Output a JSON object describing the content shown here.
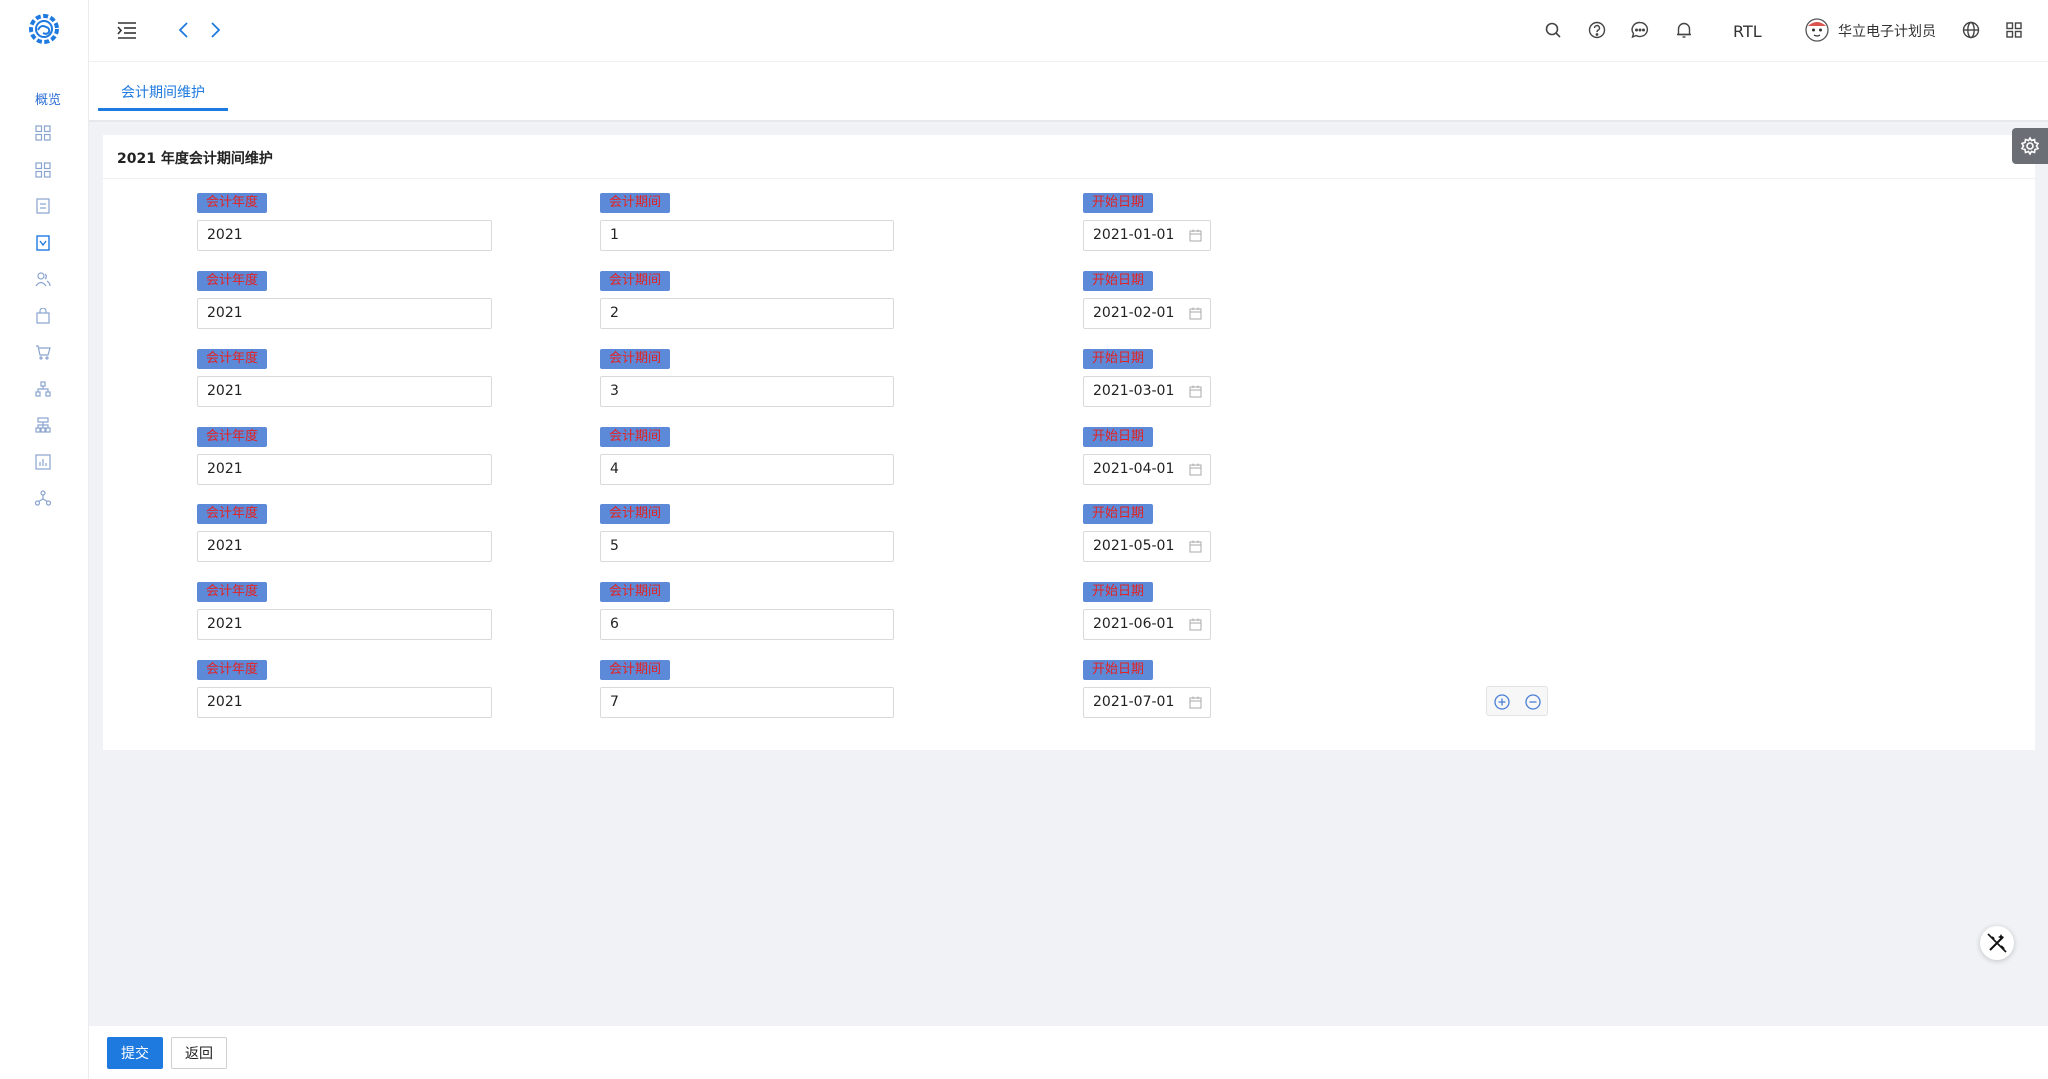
{
  "sidebar": {
    "overview_label": "概览",
    "icons": [
      "grid-icon",
      "grid-icon",
      "document-icon",
      "download-box-icon",
      "users-icon",
      "bag-icon",
      "cart-icon",
      "org-chart-icon",
      "hierarchy-icon",
      "report-icon",
      "network-icon"
    ]
  },
  "header": {
    "rtl_label": "RTL",
    "user_name": "华立电子计划员"
  },
  "tabs": {
    "active_label": "会计期间维护"
  },
  "card": {
    "title": "2021 年度会计期间维护"
  },
  "labels": {
    "year": "会计年度",
    "period": "会计期间",
    "start_date": "开始日期"
  },
  "rows": [
    {
      "year": "2021",
      "period": "1",
      "start_date": "2021-01-01"
    },
    {
      "year": "2021",
      "period": "2",
      "start_date": "2021-02-01"
    },
    {
      "year": "2021",
      "period": "3",
      "start_date": "2021-03-01"
    },
    {
      "year": "2021",
      "period": "4",
      "start_date": "2021-04-01"
    },
    {
      "year": "2021",
      "period": "5",
      "start_date": "2021-05-01"
    },
    {
      "year": "2021",
      "period": "6",
      "start_date": "2021-06-01"
    },
    {
      "year": "2021",
      "period": "7",
      "start_date": "2021-07-01"
    }
  ],
  "footer": {
    "submit_label": "提交",
    "back_label": "返回"
  },
  "colors": {
    "accent": "#1f7ae0",
    "label_bg": "#5c89d8",
    "label_text": "#e52222"
  }
}
